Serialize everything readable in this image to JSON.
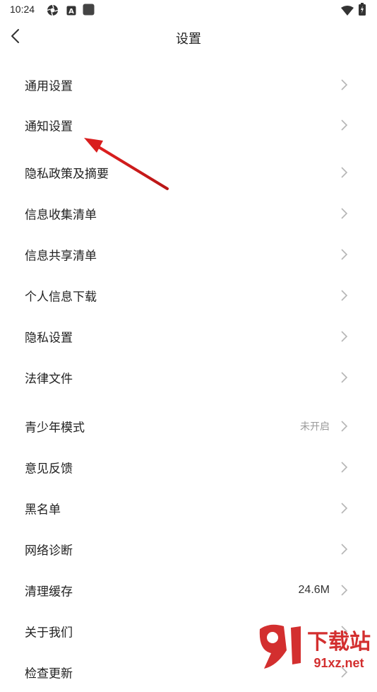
{
  "status_bar": {
    "time": "10:24",
    "icons": [
      "aperture-icon",
      "a-box-icon",
      "square-icon",
      "wifi-icon",
      "battery-icon"
    ]
  },
  "header": {
    "title": "设置",
    "back_icon": "chevron-left-icon"
  },
  "menu": {
    "items": [
      {
        "label": "通用设置",
        "value": ""
      },
      {
        "label": "通知设置",
        "value": ""
      },
      {
        "label": "隐私政策及摘要",
        "value": ""
      },
      {
        "label": "信息收集清单",
        "value": ""
      },
      {
        "label": "信息共享清单",
        "value": ""
      },
      {
        "label": "个人信息下载",
        "value": ""
      },
      {
        "label": "隐私设置",
        "value": ""
      },
      {
        "label": "法律文件",
        "value": ""
      },
      {
        "label": "青少年模式",
        "value": "未开启"
      },
      {
        "label": "意见反馈",
        "value": ""
      },
      {
        "label": "黑名单",
        "value": ""
      },
      {
        "label": "网络诊断",
        "value": ""
      },
      {
        "label": "清理缓存",
        "value": "24.6M"
      },
      {
        "label": "关于我们",
        "value": ""
      },
      {
        "label": "检查更新",
        "value": ""
      }
    ]
  },
  "annotation": {
    "color": "#d91e1e",
    "target": "通知设置"
  },
  "watermark": {
    "text_top": "下载站",
    "text_bottom": "91xz.net",
    "color": "#d32f2f"
  },
  "colors": {
    "text": "#222222",
    "secondary": "#9a9a9a",
    "chevron": "#b5b5b5"
  }
}
